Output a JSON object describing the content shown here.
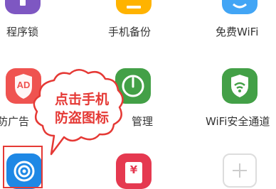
{
  "apps": [
    {
      "label": "程序锁",
      "icon": "program-lock-icon",
      "color": "#7e57c2"
    },
    {
      "label": "手机备份",
      "icon": "phone-backup-icon",
      "color": "#ffb300"
    },
    {
      "label": "免费WiFi",
      "icon": "free-wifi-icon",
      "color": "#42a5f5"
    },
    {
      "label": "防广告",
      "icon": "ad-block-icon",
      "color": "#ef5350",
      "glyph": "AD"
    },
    {
      "label": "管理",
      "icon": "power-icon",
      "color": "#43a047"
    },
    {
      "label": "WiFi安全通道",
      "icon": "wifi-security-icon",
      "color": "#43a047"
    },
    {
      "label": "",
      "icon": "anti-theft-icon",
      "color": "#1e88e5"
    },
    {
      "label": "",
      "icon": "wallet-icon",
      "color": "#e53950",
      "glyph": "¥"
    },
    {
      "label": "",
      "icon": "add-icon",
      "color": "#dddddd"
    }
  ],
  "callout": {
    "line1": "点击手机",
    "line2": "防盗图标"
  },
  "colors": {
    "accent": "#e53935"
  }
}
